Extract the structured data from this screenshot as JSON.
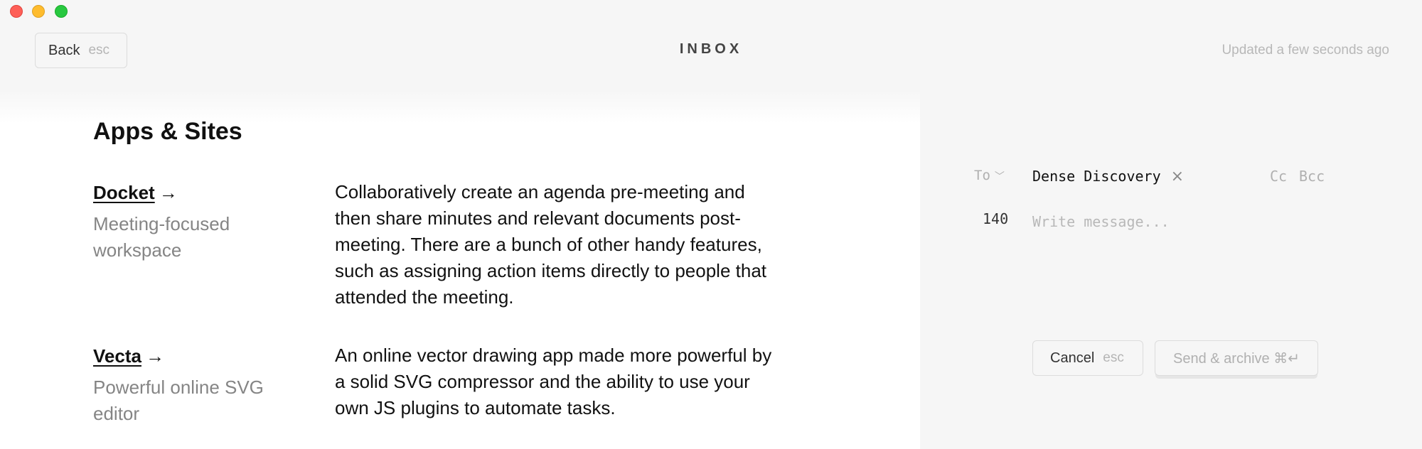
{
  "window": {
    "title": "INBOX"
  },
  "header": {
    "back_label": "Back",
    "back_hint": "esc",
    "title": "INBOX",
    "status": "Updated a few seconds ago"
  },
  "main": {
    "section_title": "Apps & Sites",
    "items": [
      {
        "name": "Docket",
        "arrow": "→",
        "tagline": "Meeting-focused workspace",
        "description": "Collaboratively create an agenda pre-meeting and then share minutes and relevant documents post-meeting. There are a bunch of other handy features, such as assigning action items directly to people that attended the meeting."
      },
      {
        "name": "Vecta",
        "arrow": "→",
        "tagline": "Powerful online SVG editor",
        "description": "An online vector drawing app made more powerful by a solid SVG compressor and the ability to use your own JS plugins to automate tasks."
      }
    ]
  },
  "compose": {
    "to_label": "To",
    "to_chevron": "﹀",
    "recipient": "Dense Discovery",
    "remove_icon": "×",
    "cc_label": "Cc",
    "bcc_label": "Bcc",
    "char_count": "140",
    "message_placeholder": "Write message...",
    "message_value": "",
    "cancel_label": "Cancel",
    "cancel_hint": "esc",
    "send_label": "Send & archive ⌘↵"
  }
}
